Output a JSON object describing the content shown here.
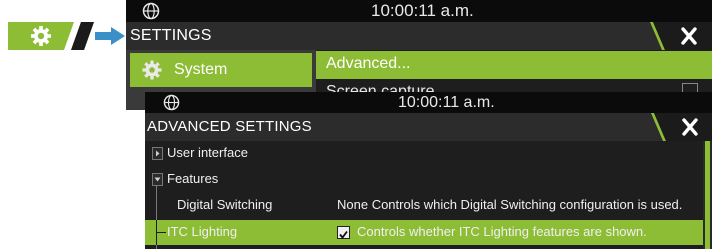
{
  "colors": {
    "accent": "#8dbc35",
    "window_bg": "#1b1b1b",
    "status_bar": "#0b0b0b",
    "title_bar": "#2c2c2c",
    "text": "#ffffff"
  },
  "shortcut": {
    "icon": "gear-icon"
  },
  "settings_window": {
    "status": {
      "icon": "globe-icon",
      "time": "10:00:11 a.m."
    },
    "title": "SETTINGS",
    "close_icon": "close-icon",
    "nav": {
      "selected": {
        "icon": "gear-icon",
        "label": "System"
      }
    },
    "content": {
      "rows": [
        {
          "label": "Advanced..."
        },
        {
          "label": "Screen capture"
        }
      ]
    }
  },
  "advanced_window": {
    "status": {
      "icon": "globe-icon",
      "time": "10:00:11 a.m."
    },
    "title": "ADVANCED SETTINGS",
    "close_icon": "close-icon",
    "tree": {
      "user_interface": {
        "label": "User interface",
        "expanded": false
      },
      "features": {
        "label": "Features",
        "expanded": true
      },
      "digital_switching": {
        "label": "Digital Switching",
        "value": "None Controls which Digital Switching configuration is used."
      },
      "itc_lighting": {
        "label": "ITC Lighting",
        "checked": true,
        "description": "Controls whether ITC Lighting features are shown."
      }
    }
  }
}
